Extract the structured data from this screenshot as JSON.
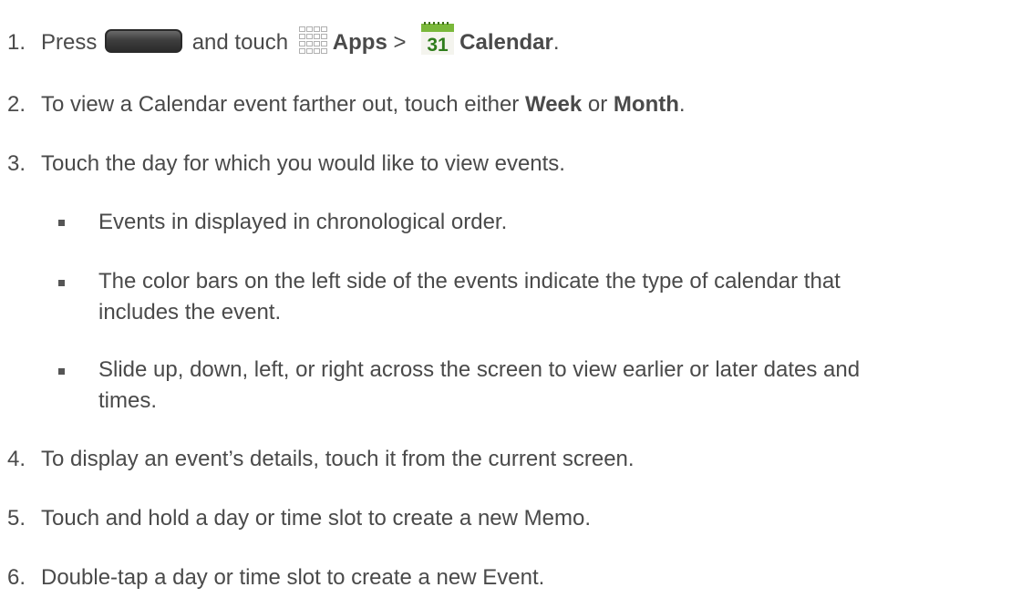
{
  "steps": [
    {
      "number": "1.",
      "press": "Press",
      "and_touch": "and touch",
      "apps_label": "Apps",
      "separator": ">",
      "calendar_label": "Calendar",
      "end": ".",
      "calendar_icon_day": "31"
    },
    {
      "number": "2.",
      "text_before": "To view a Calendar event farther out, touch either",
      "week": "Week",
      "or": "or",
      "month": "Month",
      "end": "."
    },
    {
      "number": "3.",
      "text": "Touch the day for which you would like to view events."
    },
    {
      "number": "4.",
      "text": "To display an event’s details, touch it from the current screen."
    },
    {
      "number": "5.",
      "text": "Touch and hold a day or time slot to create a new Memo."
    },
    {
      "number": "6.",
      "text": "Double-tap a day or time slot to create a new Event."
    }
  ],
  "bullets": [
    {
      "line1": "Events in displayed in chronological order."
    },
    {
      "line1": "The color bars on the left side of the events indicate the type of calendar that",
      "line2": "includes the event."
    },
    {
      "line1": "Slide up, down, left, or right across the screen to view earlier or later dates and",
      "line2": "times."
    }
  ],
  "icons": {
    "home_button": "home-key-icon",
    "apps": "apps-grid-icon",
    "calendar": "calendar-icon"
  },
  "colors": {
    "text": "#4a4a4a",
    "calendar_header": "#7ab83a",
    "calendar_number": "#2f7d1c"
  }
}
